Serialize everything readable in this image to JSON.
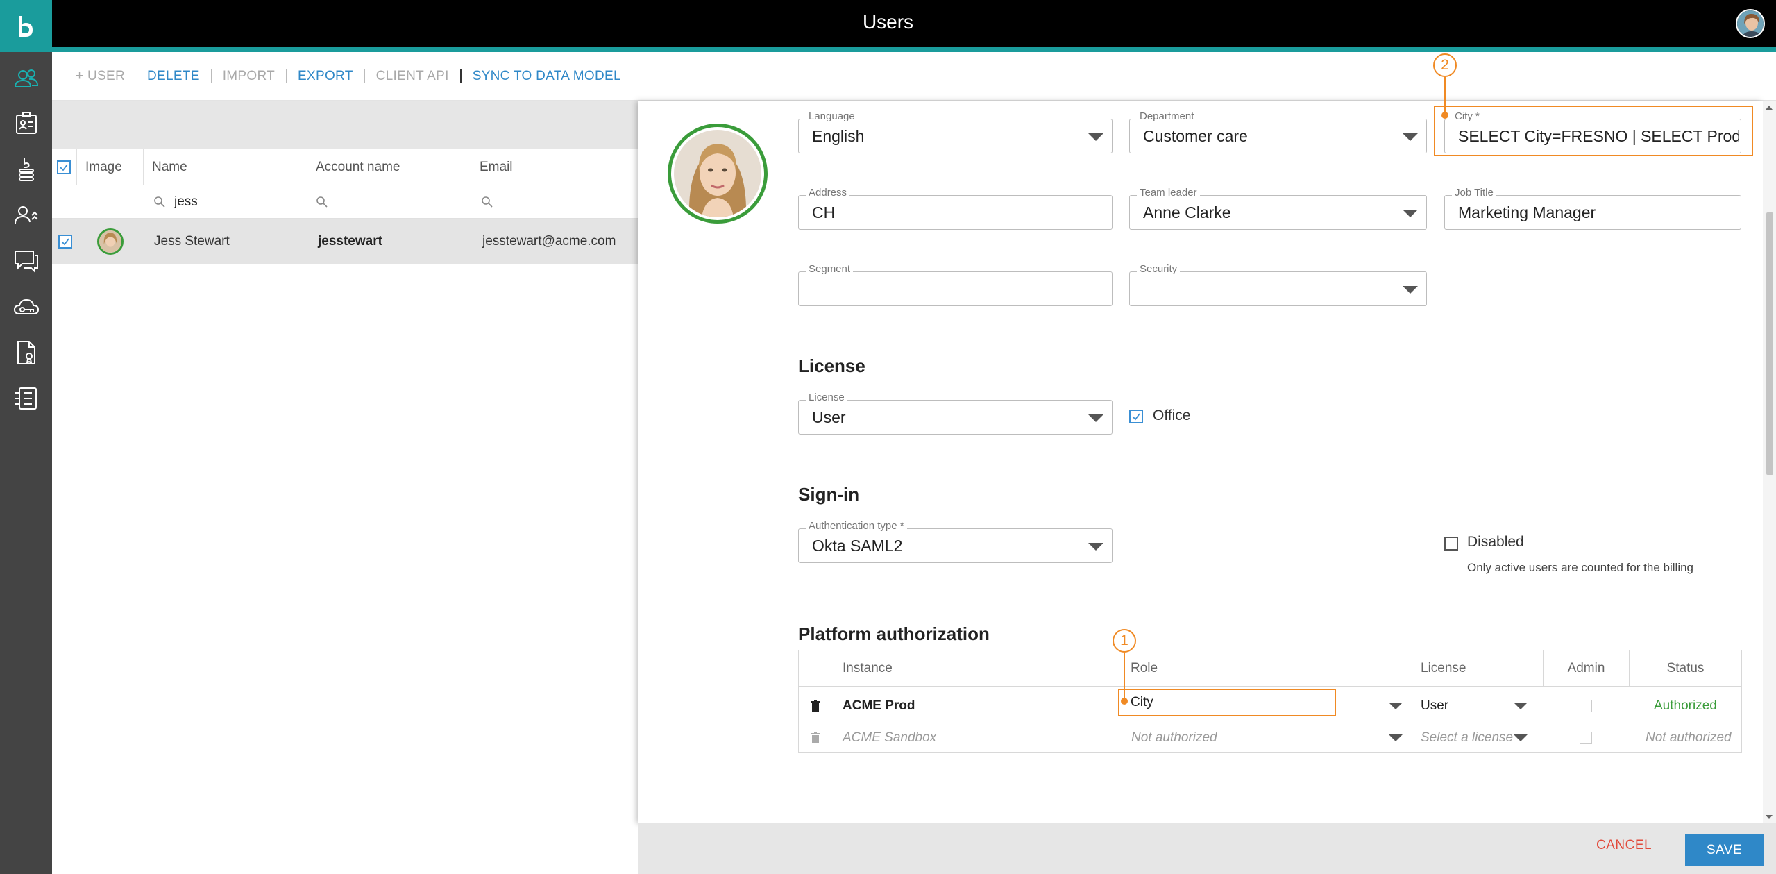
{
  "header": {
    "title": "Users"
  },
  "toolbar": {
    "add_user": "+ USER",
    "delete": "DELETE",
    "import": "IMPORT",
    "export": "EXPORT",
    "client_api": "CLIENT API",
    "sync": "SYNC TO DATA MODEL"
  },
  "sidebar": {
    "items": [
      {
        "icon": "users-icon",
        "active": true
      },
      {
        "icon": "id-card-icon"
      },
      {
        "icon": "data-stack-icon"
      },
      {
        "icon": "user-roles-icon"
      },
      {
        "icon": "chat-icon"
      },
      {
        "icon": "cloud-key-icon"
      },
      {
        "icon": "certificate-icon"
      },
      {
        "icon": "settings-list-icon"
      }
    ]
  },
  "grid": {
    "columns": [
      "Image",
      "Name",
      "Account name",
      "Email"
    ],
    "filter_name": "jess",
    "rows": [
      {
        "name": "Jess Stewart",
        "account": "jesstewart",
        "email": "jesstewart@acme.com"
      }
    ]
  },
  "form": {
    "language": {
      "label": "Language",
      "value": "English"
    },
    "department": {
      "label": "Department",
      "value": "Customer care"
    },
    "city": {
      "label": "City *",
      "value": "SELECT City=FRESNO | SELECT Product=BIKES"
    },
    "address": {
      "label": "Address",
      "value": "CH"
    },
    "team_leader": {
      "label": "Team leader",
      "value": "Anne Clarke"
    },
    "job_title": {
      "label": "Job Title",
      "value": "Marketing Manager"
    },
    "segment": {
      "label": "Segment",
      "value": ""
    },
    "security": {
      "label": "Security",
      "value": ""
    },
    "license_section": "License",
    "license": {
      "label": "License",
      "value": "User"
    },
    "office_label": "Office",
    "signin_section": "Sign-in",
    "auth_type": {
      "label": "Authentication type *",
      "value": "Okta SAML2"
    },
    "disabled_label": "Disabled",
    "disabled_hint": "Only active users are counted for the billing",
    "platform_section": "Platform authorization"
  },
  "platform": {
    "columns": [
      "Instance",
      "Role",
      "License",
      "Admin",
      "Status"
    ],
    "rows": [
      {
        "instance": "ACME Prod",
        "role": "City",
        "license": "User",
        "status": "Authorized"
      },
      {
        "instance": "ACME Sandbox",
        "role": "Not authorized",
        "license": "Select a license",
        "status": "Not authorized"
      }
    ]
  },
  "callouts": [
    "1",
    "2"
  ],
  "footer": {
    "cancel": "CANCEL",
    "save": "SAVE"
  },
  "colors": {
    "accent": "#1a9c9c",
    "link": "#2f88c8",
    "callout": "#f08a24",
    "authorized": "#3a9c3a",
    "cancel": "#e24a3b"
  }
}
